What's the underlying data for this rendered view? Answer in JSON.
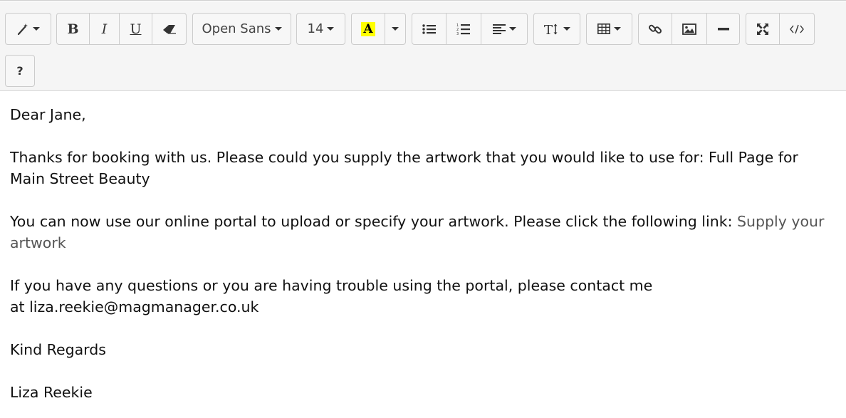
{
  "toolbar": {
    "font_name": "Open Sans",
    "font_size": "14",
    "highlight_letter": "A",
    "help_label": "?",
    "highlight_color": "#ffff00"
  },
  "icons": [
    "magic-wand-icon",
    "bold-icon",
    "italic-icon",
    "underline-icon",
    "eraser-icon",
    "unordered-list-icon",
    "ordered-list-icon",
    "align-left-icon",
    "text-height-icon",
    "table-icon",
    "link-icon",
    "image-icon",
    "horizontal-rule-icon",
    "fullscreen-icon",
    "code-view-icon"
  ],
  "message": {
    "greeting": "Dear Jane,",
    "p1": "Thanks for booking with us. Please could you supply the artwork that you would like to use for: Full Page for Main Street Beauty",
    "p2_text": "You can now use our online portal to upload or specify your artwork. Please click the following link: ",
    "p2_link": "Supply your artwork",
    "p3_line1": "If you have any questions or you are having trouble using the portal, please contact me",
    "p3_line2": "at liza.reekie@magmanager.co.uk",
    "closing": "Kind Regards",
    "signature": "Liza Reekie"
  }
}
